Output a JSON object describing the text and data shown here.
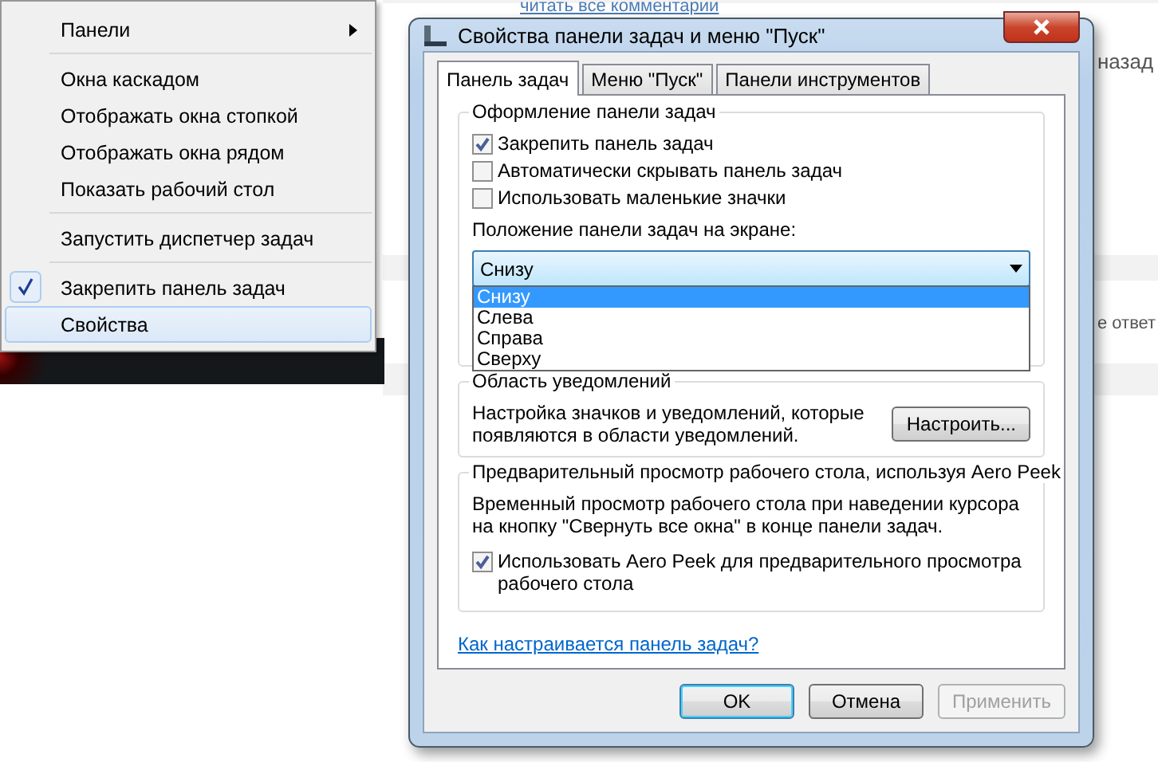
{
  "background_page": {
    "texts": [
      "читать все комментарии",
      "назад",
      "е ответ"
    ]
  },
  "context_menu": {
    "groups": [
      [
        {
          "label": "Панели",
          "has_submenu": true,
          "checked": false,
          "selected": false
        }
      ],
      [
        {
          "label": "Окна каскадом",
          "has_submenu": false,
          "checked": false,
          "selected": false
        },
        {
          "label": "Отображать окна стопкой",
          "has_submenu": false,
          "checked": false,
          "selected": false
        },
        {
          "label": "Отображать окна рядом",
          "has_submenu": false,
          "checked": false,
          "selected": false
        },
        {
          "label": "Показать рабочий стол",
          "has_submenu": false,
          "checked": false,
          "selected": false
        }
      ],
      [
        {
          "label": "Запустить диспетчер задач",
          "has_submenu": false,
          "checked": false,
          "selected": false
        }
      ],
      [
        {
          "label": "Закрепить панель задач",
          "has_submenu": false,
          "checked": true,
          "selected": false
        },
        {
          "label": "Свойства",
          "has_submenu": false,
          "checked": false,
          "selected": true
        }
      ]
    ]
  },
  "dialog": {
    "title": "Свойства панели задач и меню \"Пуск\"",
    "tabs": [
      {
        "label": "Панель задач",
        "selected": true
      },
      {
        "label": "Меню \"Пуск\"",
        "selected": false
      },
      {
        "label": "Панели инструментов",
        "selected": false
      }
    ],
    "taskbar_appearance": {
      "title": "Оформление панели задач",
      "checkboxes": [
        {
          "label": "Закрепить панель задач",
          "checked": true
        },
        {
          "label": "Автоматически скрывать панель задач",
          "checked": false
        },
        {
          "label": "Использовать маленькие значки",
          "checked": false
        }
      ],
      "position_label": "Положение панели задач на экране:",
      "position_dropdown": {
        "value": "Снизу",
        "expanded": true,
        "options": [
          {
            "label": "Снизу",
            "selected": true
          },
          {
            "label": "Слева",
            "selected": false
          },
          {
            "label": "Справа",
            "selected": false
          },
          {
            "label": "Сверху",
            "selected": false
          }
        ]
      }
    },
    "notification_area": {
      "title": "Область уведомлений",
      "description": "Настройка значков и уведомлений, которые появляются в области уведомлений.",
      "button": "Настроить..."
    },
    "aero_peek": {
      "title": "Предварительный просмотр рабочего стола, используя Aero Peek",
      "description": "Временный просмотр рабочего стола при наведении курсора на кнопку \"Свернуть все окна\" в конце панели задач.",
      "checkbox": {
        "label": "Использовать Aero Peek для предварительного просмотра рабочего стола",
        "checked": true
      }
    },
    "help_link": "Как настраивается панель задач?",
    "buttons": [
      {
        "label": "OK",
        "kind": "default",
        "disabled": false
      },
      {
        "label": "Отмена",
        "kind": "normal",
        "disabled": false
      },
      {
        "label": "Применить",
        "kind": "normal",
        "disabled": true
      }
    ]
  }
}
